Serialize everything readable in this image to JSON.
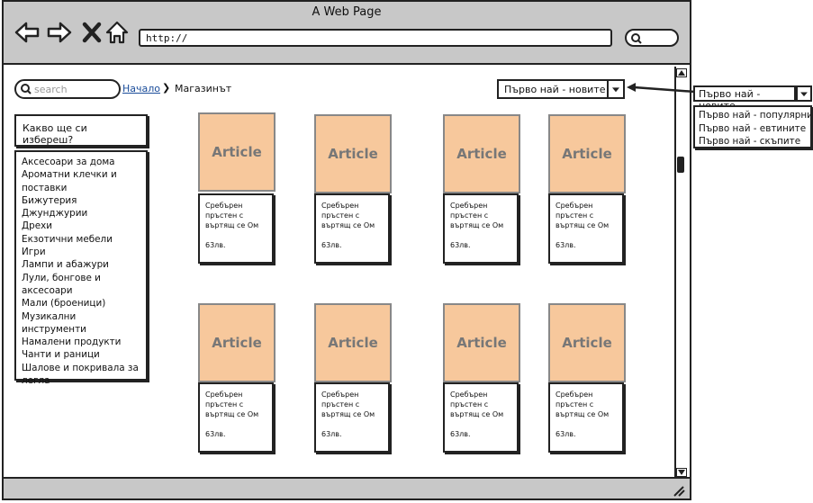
{
  "window": {
    "title": "A Web Page",
    "url": "http://"
  },
  "search": {
    "placeholder": "search"
  },
  "breadcrumb": {
    "home": "Начало",
    "separator": "❯",
    "current": "Магазинът"
  },
  "sort": {
    "selected": "Първо най - новите"
  },
  "sidebar": {
    "question": "Какво ще си избереш?",
    "categories": [
      "Аксесоари за дома",
      "Ароматни клечки и поставки",
      "Бижутерия",
      "Джунджурии",
      "Дрехи",
      "Екзотични мебели",
      "Игри",
      "Лампи и абажури",
      "Лули, бонгове и аксесоари",
      "Мали (броеници)",
      "Музикални инструменти",
      "Намалени продукти",
      "Чанти и раници",
      "Шалове и покривала за легла"
    ]
  },
  "products": [
    {
      "image": "Article",
      "name": "Сребърен пръстен с въртящ се Ом",
      "price": "63лв."
    },
    {
      "image": "Article",
      "name": "Сребърен пръстен с въртящ се Ом",
      "price": "63лв."
    },
    {
      "image": "Article",
      "name": "Сребърен пръстен с въртящ се Ом",
      "price": "63лв."
    },
    {
      "image": "Article",
      "name": "Сребърен пръстен с въртящ се Ом",
      "price": "63лв."
    },
    {
      "image": "Article",
      "name": "Сребърен пръстен с въртящ се Ом",
      "price": "63лв."
    },
    {
      "image": "Article",
      "name": "Сребърен пръстен с въртящ се Ом",
      "price": "63лв."
    },
    {
      "image": "Article",
      "name": "Сребърен пръстен с въртящ се Ом",
      "price": "63лв."
    },
    {
      "image": "Article",
      "name": "Сребърен пръстен с въртящ се Ом",
      "price": "63лв."
    }
  ],
  "sort_dropdown": {
    "selected": "Първо най - новите",
    "options": [
      "Първо най - популярните",
      "Първо най - евтините",
      "Първо най - скъпите"
    ]
  },
  "colors": {
    "frame_gray": "#c8c8c8",
    "article_fill": "#f7c89c",
    "link": "#1a4c9a"
  }
}
